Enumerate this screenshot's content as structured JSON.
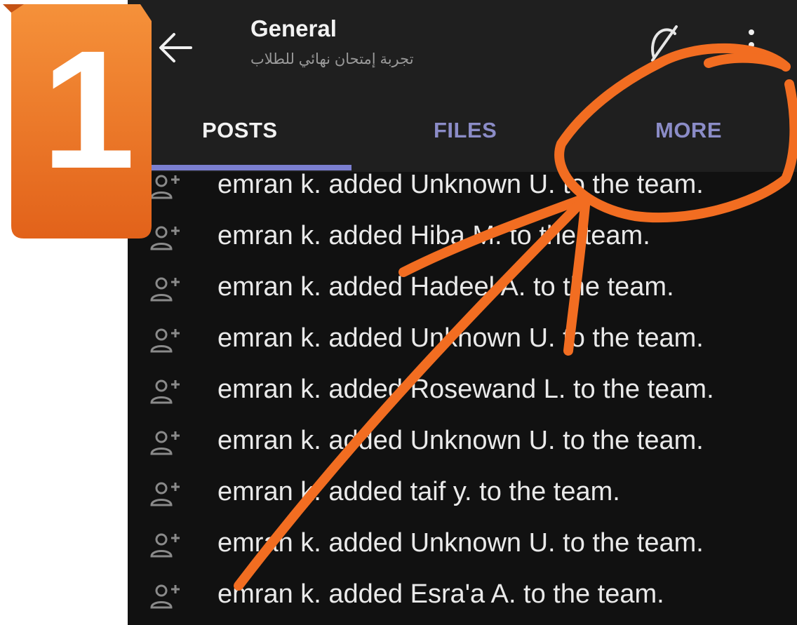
{
  "badge": {
    "number": "1",
    "color": "#e8701a"
  },
  "header": {
    "title": "General",
    "subtitle": "تجربة إمتحان نهائي للطلاب",
    "icons": [
      "back-arrow-icon",
      "meet-now-icon",
      "more-options-icon"
    ]
  },
  "tabs": [
    {
      "label": "POSTS",
      "active": true
    },
    {
      "label": "FILES",
      "active": false
    },
    {
      "label": "MORE",
      "active": false
    }
  ],
  "posts": [
    {
      "text": "emran k. added Unknown U. to the team."
    },
    {
      "text": "emran k. added Hiba M. to the team."
    },
    {
      "text": "emran k. added Hadeel A. to the team."
    },
    {
      "text": "emran k. added Unknown U. to the team."
    },
    {
      "text": "emran k. added Rosewand L. to the team."
    },
    {
      "text": "emran k. added Unknown U. to the team."
    },
    {
      "text": "emran k. added taif y. to the team."
    },
    {
      "text": "emran k. added Unknown U. to the team."
    },
    {
      "text": "emran k. added Esra'a A. to the team."
    }
  ],
  "colors": {
    "accent": "#7b7fd0",
    "annotation": "#f26d21",
    "background": "#111111"
  }
}
